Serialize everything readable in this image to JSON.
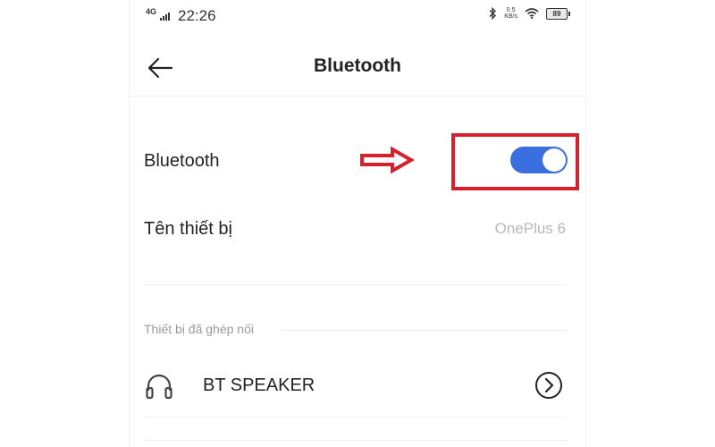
{
  "status_bar": {
    "network": "4G",
    "time": "22:26",
    "speed_value": "0.5",
    "speed_unit": "KB/s",
    "battery": "89"
  },
  "header": {
    "title": "Bluetooth",
    "back_icon": "back-arrow-icon"
  },
  "bluetooth_row": {
    "label": "Bluetooth",
    "enabled": true
  },
  "device_name_row": {
    "label": "Tên thiết bị",
    "value": "OnePlus 6"
  },
  "paired_section": {
    "header": "Thiết bị đã ghép nối",
    "devices": [
      {
        "name": "BT SPEAKER",
        "icon": "headphone-icon",
        "action_icon": "chevron-right-circle-icon"
      }
    ]
  },
  "annotation": {
    "arrow_color": "#d7202b",
    "box_color": "#d7202b"
  },
  "colors": {
    "toggle_on": "#3b6fe0",
    "secondary_text": "#b8b8b8"
  }
}
